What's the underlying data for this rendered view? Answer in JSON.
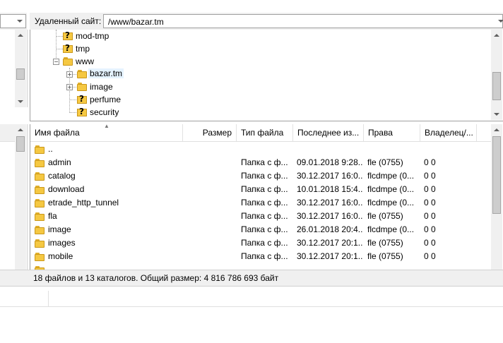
{
  "remote_site": {
    "label": "Удаленный сайт:",
    "path": "/www/bazar.tm"
  },
  "tree": {
    "items": [
      {
        "label": "mod-tmp",
        "icon": "question-folder-icon"
      },
      {
        "label": "tmp",
        "icon": "question-folder-icon"
      },
      {
        "label": "www",
        "icon": "folder-icon",
        "expander": "−"
      },
      {
        "label": "bazar.tm",
        "icon": "folder-icon",
        "expander": "+",
        "selected": true
      },
      {
        "label": "image",
        "icon": "folder-icon",
        "expander": "+"
      },
      {
        "label": "perfume",
        "icon": "question-folder-icon"
      },
      {
        "label": "security",
        "icon": "question-folder-icon"
      }
    ]
  },
  "file_list": {
    "columns": [
      "Имя файла",
      "Размер",
      "Тип файла",
      "Последнее из...",
      "Права",
      "Владелец/..."
    ],
    "rows": [
      {
        "name": "..",
        "size": "",
        "type": "",
        "modified": "",
        "perms": "",
        "owner": ""
      },
      {
        "name": "admin",
        "size": "",
        "type": "Папка с ф...",
        "modified": "09.01.2018 9:28...",
        "perms": "fle (0755)",
        "owner": "0 0"
      },
      {
        "name": "catalog",
        "size": "",
        "type": "Папка с ф...",
        "modified": "30.12.2017 16:0...",
        "perms": "flcdmpe (0...",
        "owner": "0 0"
      },
      {
        "name": "download",
        "size": "",
        "type": "Папка с ф...",
        "modified": "10.01.2018 15:4...",
        "perms": "flcdmpe (0...",
        "owner": "0 0"
      },
      {
        "name": "etrade_http_tunnel",
        "size": "",
        "type": "Папка с ф...",
        "modified": "30.12.2017 16:0...",
        "perms": "flcdmpe (0...",
        "owner": "0 0"
      },
      {
        "name": "fla",
        "size": "",
        "type": "Папка с ф...",
        "modified": "30.12.2017 16:0...",
        "perms": "fle (0755)",
        "owner": "0 0"
      },
      {
        "name": "image",
        "size": "",
        "type": "Папка с ф...",
        "modified": "26.01.2018 20:4...",
        "perms": "flcdmpe (0...",
        "owner": "0 0"
      },
      {
        "name": "images",
        "size": "",
        "type": "Папка с ф...",
        "modified": "30.12.2017 20:1...",
        "perms": "fle (0755)",
        "owner": "0 0"
      },
      {
        "name": "mobile",
        "size": "",
        "type": "Папка с ф...",
        "modified": "30.12.2017 20:1...",
        "perms": "fle (0755)",
        "owner": "0 0"
      }
    ]
  },
  "status": {
    "summary": "18 файлов и 13 каталогов. Общий размер: 4 816 786 693 байт"
  },
  "colors": {
    "panel": "#f0f0f0",
    "border": "#a0a0a0",
    "selected": "#e5f3ff",
    "folder": "#f5c842"
  }
}
